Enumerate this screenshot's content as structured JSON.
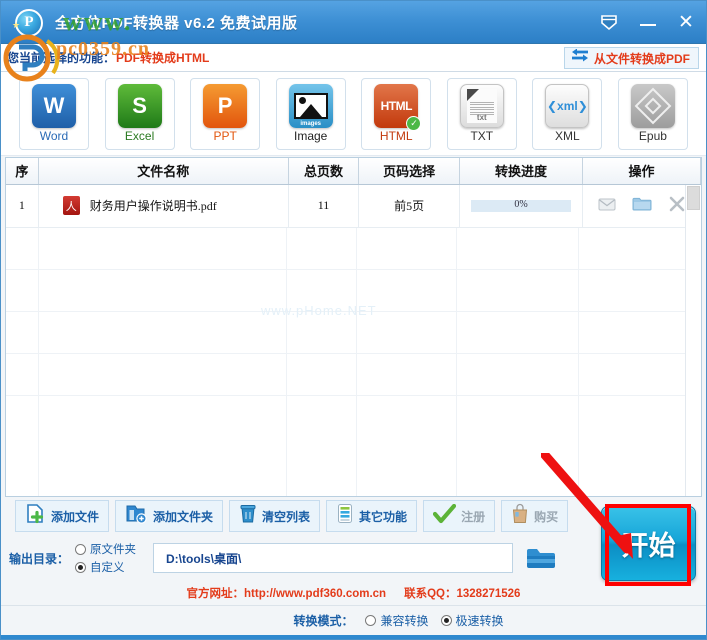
{
  "window": {
    "title": "全方位PDF转换器 v6.2 免费试用版",
    "logo_icon": "pdf-circle-logo-icon",
    "collapse_icon": "collapse-arrow-icon",
    "minimize_icon": "minimize-icon",
    "close_icon": "close-icon"
  },
  "subheader": {
    "function_label": "您当前选择的功能：",
    "function_value": "PDF转换成HTML",
    "convert_button": {
      "label": "从文件转换成PDF",
      "icon": "swap-arrows-icon"
    }
  },
  "formats": [
    {
      "key": "word",
      "caption": "Word",
      "glyph": "W",
      "icon": "word-format-icon",
      "selected": false
    },
    {
      "key": "excel",
      "caption": "Excel",
      "glyph": "S",
      "icon": "excel-format-icon",
      "selected": false
    },
    {
      "key": "ppt",
      "caption": "PPT",
      "glyph": "P",
      "icon": "ppt-format-icon",
      "selected": false
    },
    {
      "key": "image",
      "caption": "Image",
      "glyph": "images",
      "icon": "image-format-icon",
      "selected": false
    },
    {
      "key": "html",
      "caption": "HTML",
      "glyph": "HTML",
      "icon": "html-format-icon",
      "selected": true,
      "badge": "✓"
    },
    {
      "key": "txt",
      "caption": "TXT",
      "glyph": "txt",
      "icon": "txt-format-icon",
      "selected": false
    },
    {
      "key": "xml",
      "caption": "XML",
      "glyph": "❮xml❯",
      "icon": "xml-format-icon",
      "selected": false
    },
    {
      "key": "epub",
      "caption": "Epub",
      "glyph": "",
      "icon": "epub-format-icon",
      "selected": false
    }
  ],
  "table": {
    "headers": [
      "序",
      "文件名称",
      "总页数",
      "页码选择",
      "转换进度",
      "操作"
    ],
    "rows": [
      {
        "index": "1",
        "filename": "财务用户操作说明书.pdf",
        "file_icon": "pdf-file-icon",
        "total_pages": "11",
        "page_selection": "前5页",
        "progress": "0%",
        "progress_percent": 0,
        "actions": [
          "mail-icon",
          "folder-icon",
          "remove-icon"
        ]
      }
    ],
    "empty_row_count": 4,
    "watermark": "www.pHome.NET"
  },
  "toolbar_buttons": [
    {
      "label": "添加文件",
      "icon": "add-file-icon",
      "disabled": false
    },
    {
      "label": "添加文件夹",
      "icon": "add-folder-icon",
      "disabled": false
    },
    {
      "label": "清空列表",
      "icon": "trash-icon",
      "disabled": false
    },
    {
      "label": "其它功能",
      "icon": "list-icon",
      "disabled": false
    },
    {
      "label": "注册",
      "icon": "check-icon",
      "disabled": true
    },
    {
      "label": "购买",
      "icon": "shopping-bag-icon",
      "disabled": true
    }
  ],
  "output": {
    "label": "输出目录：",
    "options": [
      {
        "label": "原文件夹",
        "checked": false
      },
      {
        "label": "自定义",
        "checked": true
      }
    ],
    "path": "D:\\tools\\桌面\\",
    "browse_icon": "folder-browse-icon"
  },
  "footer": {
    "website": "官方网址：http://www.pdf360.com.cn",
    "qq": "联系QQ：1328271526"
  },
  "mode": {
    "label": "转换模式：",
    "options": [
      {
        "label": "兼容转换",
        "checked": false
      },
      {
        "label": "极速转换",
        "checked": true
      }
    ]
  },
  "start_button": {
    "label": "开始"
  },
  "annotation": {
    "box_color": "#ff0000",
    "arrow_color": "#ee1111"
  },
  "watermarks": {
    "text_green": "www.",
    "text_orange": "pc0359.cn"
  },
  "colors": {
    "titlebar_from": "#55a3e2",
    "titlebar_to": "#2c7fc6",
    "accent_red": "#e33b1a",
    "accent_blue": "#17458f",
    "start_button": "#16a5d8"
  }
}
